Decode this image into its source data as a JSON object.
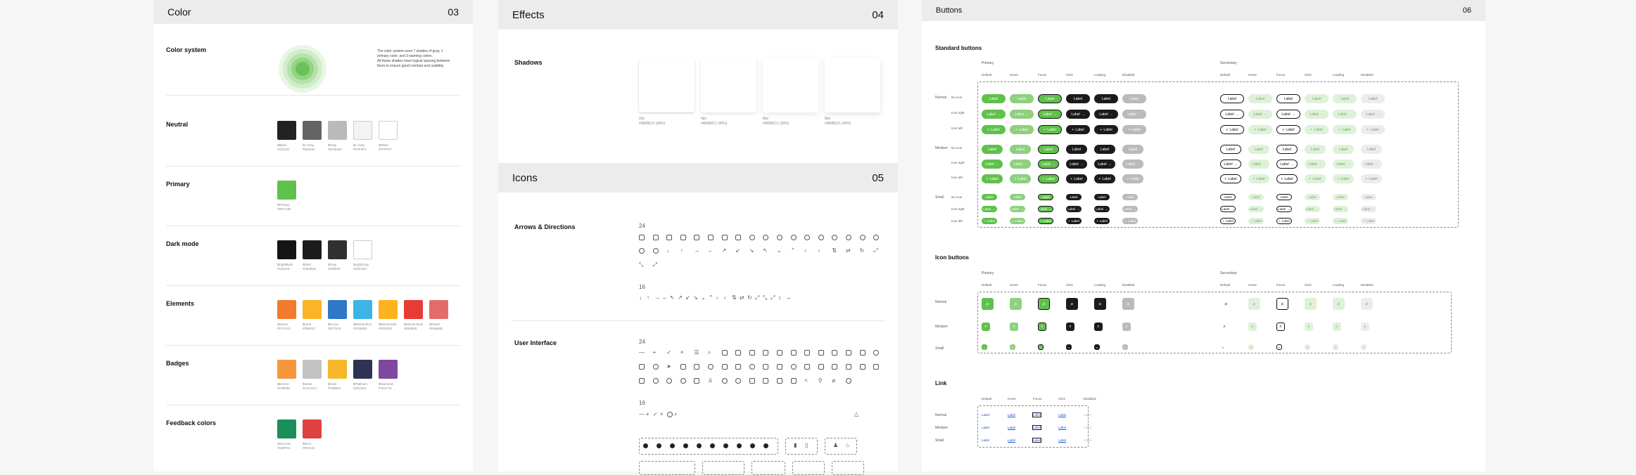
{
  "color": {
    "title": "Color",
    "number": "03",
    "system": {
      "label": "Color system",
      "desc1": "The color system uses 7 shades of gray, 1",
      "desc2": "primary color, and 3 warning colors.",
      "desc3": "All these shades have logical spacing between",
      "desc4": "them to ensure good contrast and usability."
    },
    "neutral": {
      "label": "Neutral",
      "swatches": [
        {
          "name": "$Black",
          "hex": "#222222",
          "color": "#222222"
        },
        {
          "name": "$L.Gray",
          "hex": "#646464",
          "color": "#646464"
        },
        {
          "name": "$Gray",
          "hex": "#BABABA",
          "color": "#BABABA"
        },
        {
          "name": "$L.Gray",
          "hex": "#F3F3F3",
          "color": "#F3F3F3"
        },
        {
          "name": "$White",
          "hex": "#FFFFFF",
          "color": "#FFFFFF"
        }
      ]
    },
    "primary": {
      "label": "Primary",
      "swatches": [
        {
          "name": "$Primary",
          "hex": "#5FC14B",
          "color": "#5FC14B"
        }
      ]
    },
    "dark": {
      "label": "Dark mode",
      "swatches": [
        {
          "name": "$LightBack",
          "hex": "#151515",
          "color": "#151515"
        },
        {
          "name": "$Dark",
          "hex": "#1B1B1B",
          "color": "#1B1B1B"
        },
        {
          "name": "$Gray",
          "hex": "#303030",
          "color": "#303030"
        },
        {
          "name": "$LightGray",
          "hex": "#E2E2E2",
          "color": "#FFFFFF"
        }
      ]
    },
    "elements": {
      "label": "Elements",
      "swatches": [
        {
          "name": "$Green",
          "hex": "#F37A2C",
          "color": "#F37A2C"
        },
        {
          "name": "$Lime",
          "hex": "#FBB327",
          "color": "#FBB327"
        },
        {
          "name": "$Focus",
          "hex": "#2F78C5",
          "color": "#2F78C5"
        },
        {
          "name": "$ElementFoc",
          "hex": "#3CB5E5",
          "color": "#3CB5E5"
        },
        {
          "name": "$ElementSel",
          "hex": "#FEB31E",
          "color": "#FEB31E"
        },
        {
          "name": "$ElementSub",
          "hex": "#E83B35",
          "color": "#E83B35"
        },
        {
          "name": "$Pastel",
          "hex": "#E56B6B",
          "color": "#E56B6B"
        }
      ]
    },
    "badges": {
      "label": "Badges",
      "swatches": [
        {
          "name": "$Bronze",
          "hex": "#F8963E",
          "color": "#F8963E"
        },
        {
          "name": "$Silver",
          "hex": "#C2C2C2",
          "color": "#C2C2C2"
        },
        {
          "name": "$Gold",
          "hex": "#F6B82A",
          "color": "#F6B82A"
        },
        {
          "name": "$Platinum",
          "hex": "#2D3453",
          "color": "#2D3453"
        },
        {
          "name": "$Diamond",
          "hex": "#7E47A0",
          "color": "#7E47A0"
        }
      ]
    },
    "feedback": {
      "label": "Feedback colors",
      "swatches": [
        {
          "name": "$Success",
          "hex": "#1B8F5A",
          "color": "#1B8F5A"
        },
        {
          "name": "$Error",
          "hex": "#E04141",
          "color": "#E04141"
        }
      ]
    }
  },
  "effects": {
    "title": "Effects",
    "number": "04",
    "shadows_label": "Shadows",
    "shadows": [
      {
        "l1": "2px",
        "l2": "#ABBED1 (80%)"
      },
      {
        "l1": "4px",
        "l2": "#ABBED1 (40%)"
      },
      {
        "l1": "8px",
        "l2": "#ABBED1 (30%)"
      },
      {
        "l1": "8px",
        "l2": "#ABBED1 (40%)"
      }
    ]
  },
  "icons": {
    "title": "Icons",
    "number": "05",
    "arrows_label": "Arrows & Directions",
    "ui_label": "User Interface",
    "size24": "24",
    "size16": "16"
  },
  "buttons": {
    "title": "Buttons",
    "number": "06",
    "standard": "Standard buttons",
    "icon_buttons": "Icon buttons",
    "link": "Link",
    "primary": "Primary",
    "secondary": "Secondary",
    "states": [
      "Default",
      "Hover",
      "Focus",
      "Click",
      "Loading",
      "Disabled"
    ],
    "sizes": [
      "Normal",
      "Medium",
      "Small"
    ],
    "variants": [
      "No icon",
      "Icon right",
      "Icon left"
    ],
    "label": "Label",
    "link_states": [
      "Default",
      "Hover",
      "Focus",
      "Click",
      "Disabled"
    ]
  }
}
